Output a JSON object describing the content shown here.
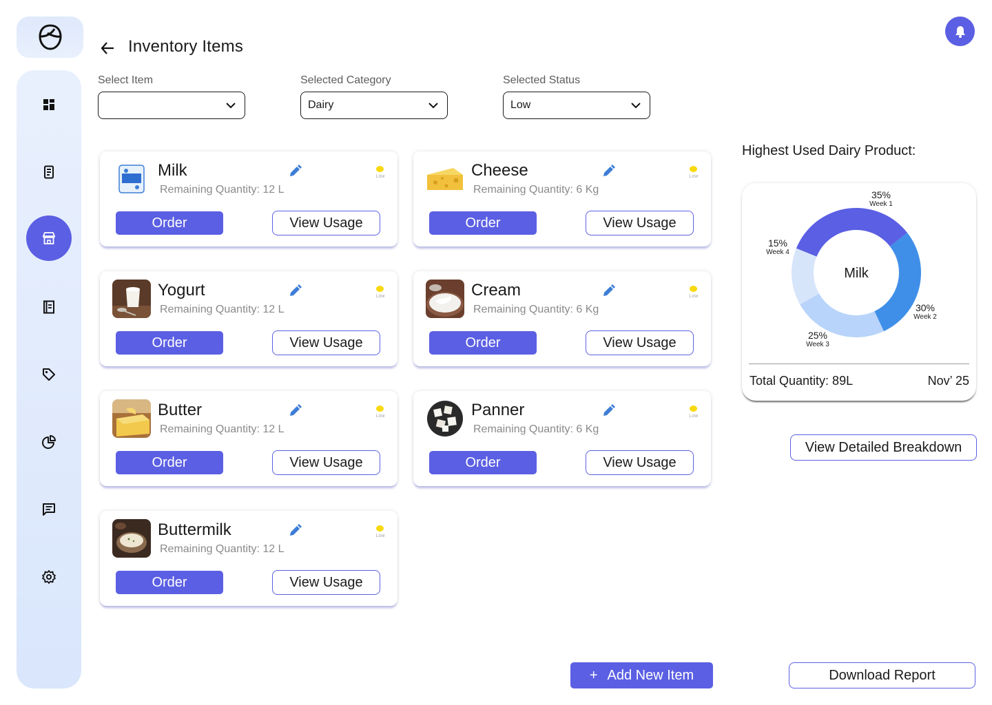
{
  "header": {
    "title": "Inventory Items"
  },
  "sidebar": {
    "items": [
      {
        "icon": "dashboard-icon"
      },
      {
        "icon": "receipt-icon"
      },
      {
        "icon": "store-icon",
        "active": true
      },
      {
        "icon": "notebook-icon"
      },
      {
        "icon": "tag-icon"
      },
      {
        "icon": "pie-chart-icon"
      },
      {
        "icon": "message-icon"
      },
      {
        "icon": "settings-icon"
      }
    ]
  },
  "filters": {
    "item": {
      "label": "Select Item",
      "value": ""
    },
    "category": {
      "label": "Selected Category",
      "value": "Dairy"
    },
    "status": {
      "label": "Selected Status",
      "value": "Low"
    }
  },
  "items": [
    {
      "name": "Milk",
      "quantity": "Remaining Quantity: 12 L",
      "status": "Low",
      "order_label": "Order",
      "usage_label": "View Usage"
    },
    {
      "name": "Cheese",
      "quantity": "Remaining Quantity: 6 Kg",
      "status": "Low",
      "order_label": "Order",
      "usage_label": "View Usage"
    },
    {
      "name": "Yogurt",
      "quantity": "Remaining Quantity: 12 L",
      "status": "Low",
      "order_label": "Order",
      "usage_label": "View Usage"
    },
    {
      "name": "Cream",
      "quantity": "Remaining Quantity: 6 Kg",
      "status": "Low",
      "order_label": "Order",
      "usage_label": "View Usage"
    },
    {
      "name": "Butter",
      "quantity": "Remaining Quantity: 12 L",
      "status": "Low",
      "order_label": "Order",
      "usage_label": "View Usage"
    },
    {
      "name": "Panner",
      "quantity": "Remaining Quantity: 6 Kg",
      "status": "Low",
      "order_label": "Order",
      "usage_label": "View Usage"
    },
    {
      "name": "Buttermilk",
      "quantity": "Remaining Quantity: 12 L",
      "status": "Low",
      "order_label": "Order",
      "usage_label": "View Usage"
    }
  ],
  "usage_panel": {
    "title": "Highest Used Dairy Product:",
    "total": "Total Quantity: 89L",
    "date": "Nov’ 25",
    "detail_label": "View Detailed Breakdown"
  },
  "chart_data": {
    "type": "pie",
    "center_label": "Milk",
    "slices": [
      {
        "pct_label": "35%",
        "week": "Week 1",
        "value": 35,
        "color": "#5b5fe3"
      },
      {
        "pct_label": "30%",
        "week": "Week 2",
        "value": 30,
        "color": "#3f8fe8"
      },
      {
        "pct_label": "25%",
        "week": "Week 3",
        "value": 25,
        "color": "#b9d4fa"
      },
      {
        "pct_label": "15%",
        "week": "Week 4",
        "value": 15,
        "color": "#d7e5fb"
      }
    ]
  },
  "actions": {
    "add_label": "Add New Item",
    "add_icon": "+",
    "download_label": "Download Report"
  },
  "colors": {
    "accent": "#5b5fe3",
    "sidebar": "#dfe9fb",
    "status_low": "#f8d90f"
  }
}
